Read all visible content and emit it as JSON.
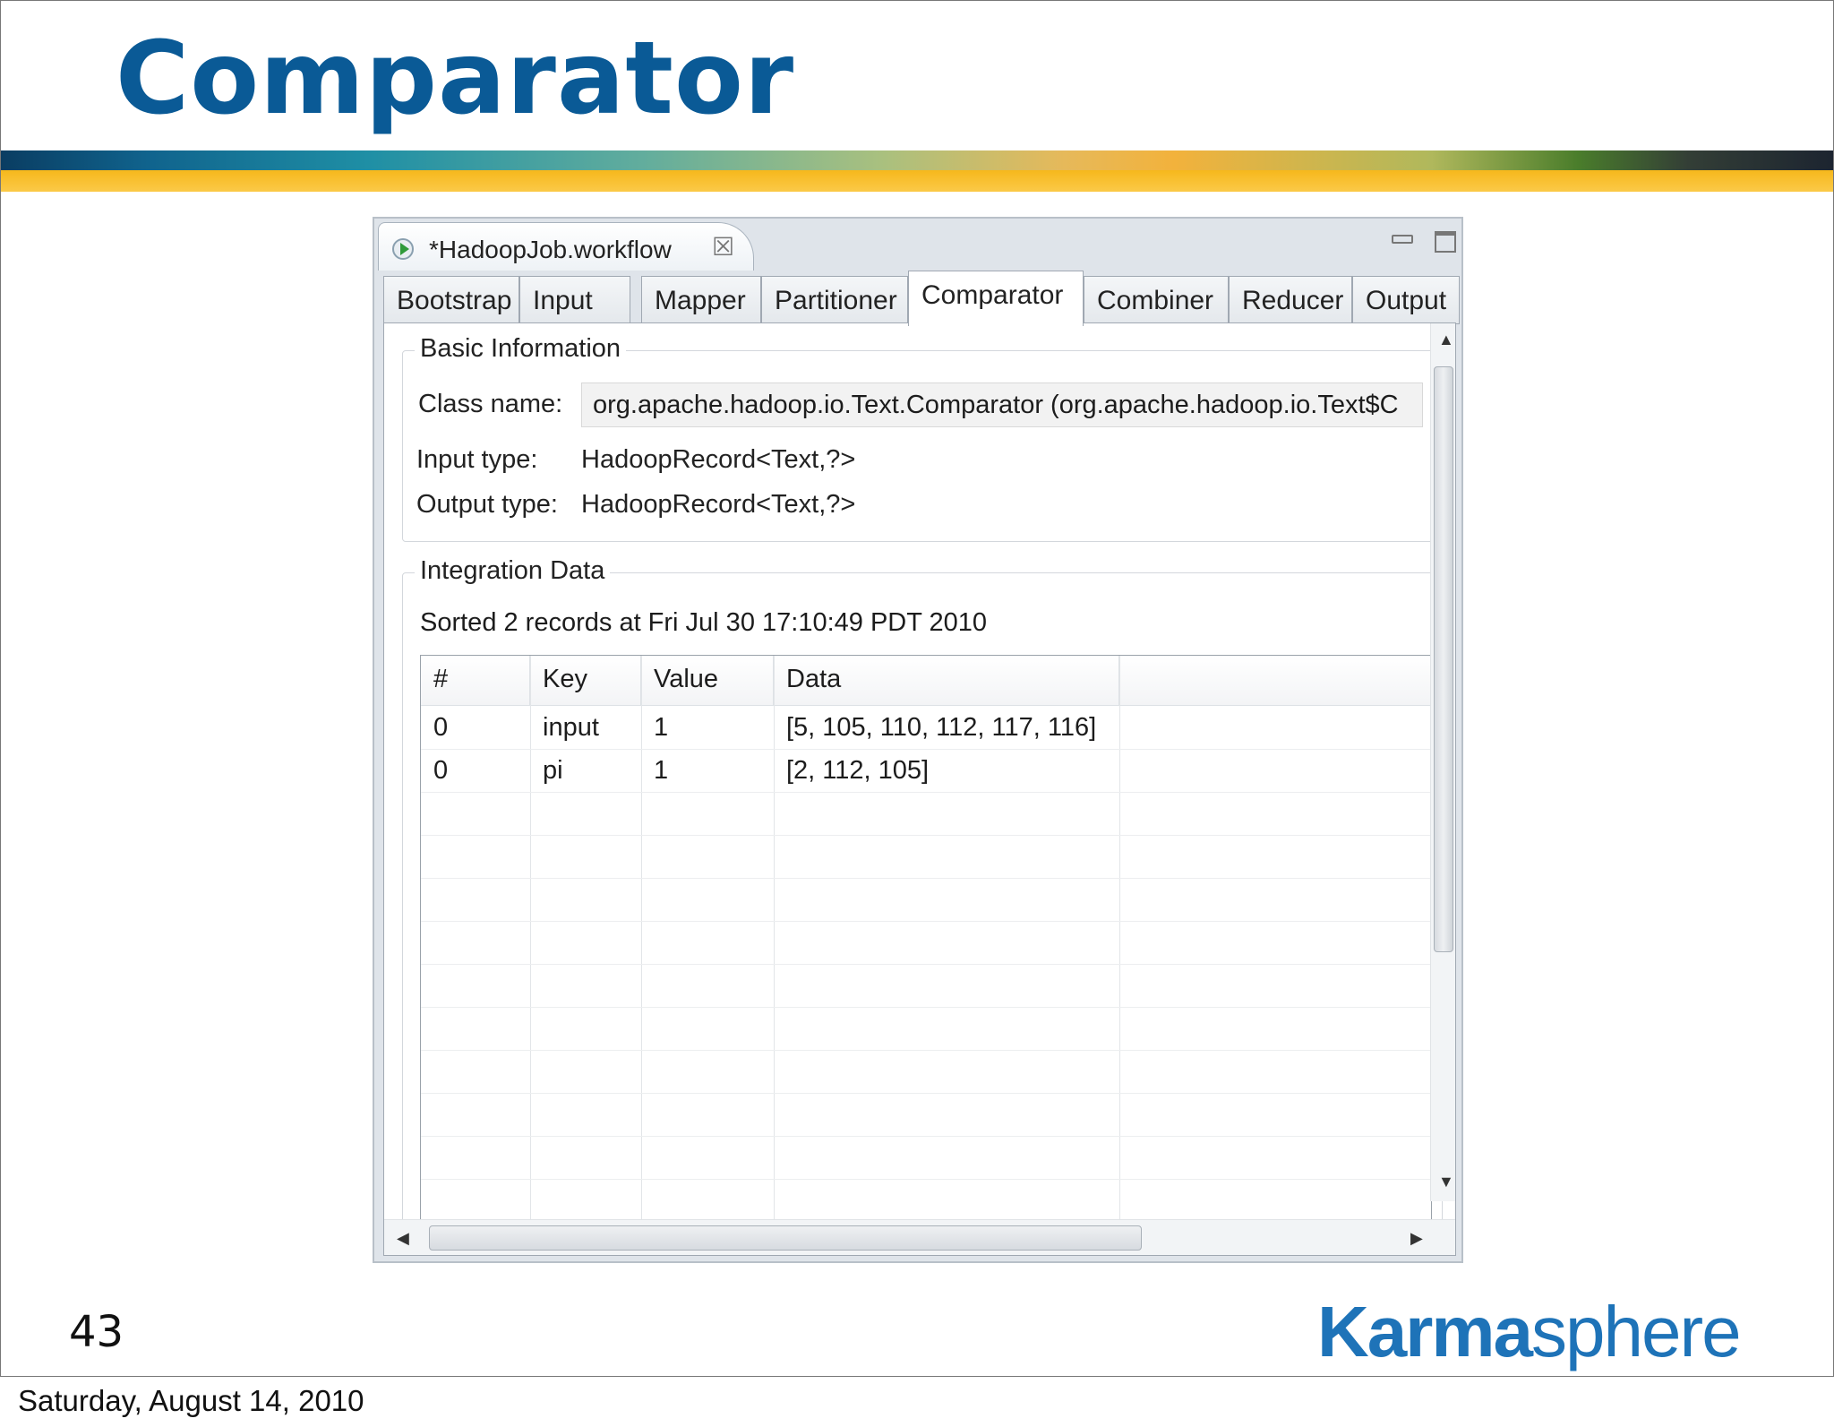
{
  "slide": {
    "title": "Comparator",
    "page_number": "43",
    "footer_date": "Saturday, August 14, 2010",
    "logo": {
      "bold": "Karma",
      "light": "sphere"
    },
    "colors": {
      "title": "#0a5a96",
      "logo": "#1e73b8",
      "band_yellow": "#f6b81c"
    }
  },
  "editor": {
    "tab_title": "*HadoopJob.workflow",
    "tab_icon": "run-icon",
    "close_icon": "close-icon",
    "page_tabs": [
      "Bootstrap",
      "Input",
      "Mapper",
      "Partitioner",
      "Comparator",
      "Combiner",
      "Reducer",
      "Output"
    ],
    "active_tab": "Comparator"
  },
  "basic_info": {
    "title": "Basic Information",
    "class_label": "Class name:",
    "class_value": "org.apache.hadoop.io.Text.Comparator (org.apache.hadoop.io.Text$C",
    "input_label": "Input type:",
    "input_value": "HadoopRecord<Text,?>",
    "output_label": "Output type:",
    "output_value": "HadoopRecord<Text,?>"
  },
  "integration": {
    "title": "Integration Data",
    "status": "Sorted 2 records at Fri Jul 30 17:10:49 PDT 2010",
    "columns": [
      "#",
      "Key",
      "Value",
      "Data"
    ],
    "rows": [
      [
        "0",
        "input",
        "1",
        "[5, 105, 110, 112, 117, 116]"
      ],
      [
        "0",
        "pi",
        "1",
        "[2, 112, 105]"
      ]
    ]
  }
}
